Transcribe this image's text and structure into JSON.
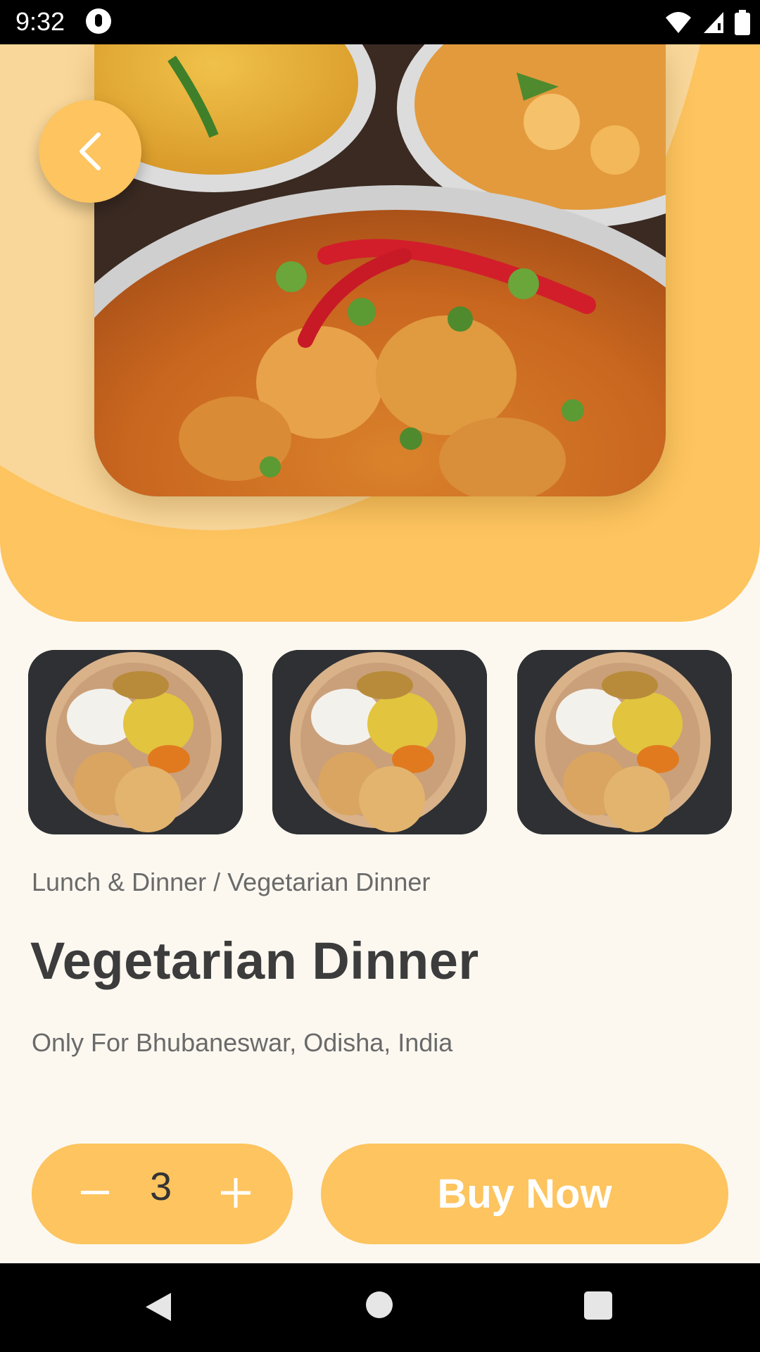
{
  "status_bar": {
    "time": "9:32"
  },
  "hero": {
    "image_alt": "Curry dish with red chilies"
  },
  "thumbnails": [
    {
      "alt": "Vegetarian thali plate"
    },
    {
      "alt": "Vegetarian thali plate"
    },
    {
      "alt": "Vegetarian thali plate"
    }
  ],
  "product": {
    "breadcrumb": "Lunch & Dinner / Vegetarian Dinner",
    "title": "Vegetarian Dinner",
    "location": "Only For Bhubaneswar, Odisha, India"
  },
  "cart": {
    "quantity": "3",
    "buy_label": "Buy Now"
  },
  "colors": {
    "accent": "#FDC45F",
    "background": "#FCF8F0"
  },
  "icons": [
    "back-arrow-icon",
    "minus-icon",
    "plus-icon",
    "wifi-icon",
    "signal-icon",
    "battery-icon"
  ]
}
